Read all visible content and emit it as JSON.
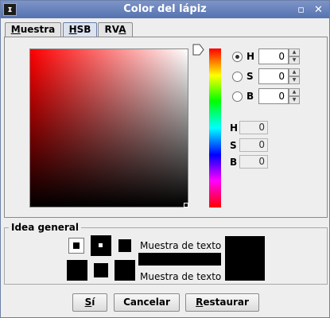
{
  "window": {
    "title": "Color del lápiz"
  },
  "titlebar": {
    "icon": "app-icon",
    "minimize": "minimize-icon",
    "close": "close-icon"
  },
  "tabs": [
    {
      "label": "Muestra",
      "mnemonic": "M",
      "rest": "uestra",
      "active": false
    },
    {
      "label": "HSB",
      "mnemonic": "H",
      "rest": "SB",
      "active": true
    },
    {
      "label": "RVA",
      "pre": "RV",
      "mnemonic": "A",
      "active": false
    }
  ],
  "hsb": {
    "current_color": "#000000",
    "hue_color": "#ff0000",
    "fields": [
      {
        "label": "H",
        "value": "0",
        "selected": true
      },
      {
        "label": "S",
        "value": "0",
        "selected": false
      },
      {
        "label": "B",
        "value": "0",
        "selected": false
      }
    ],
    "readouts": [
      {
        "label": "H",
        "value": "0"
      },
      {
        "label": "S",
        "value": "0"
      },
      {
        "label": "B",
        "value": "0"
      }
    ]
  },
  "preview": {
    "title": "Idea general",
    "sample_text_1": "Muestra de texto",
    "sample_text_2": "Muestra de texto",
    "color": "#000000"
  },
  "buttons": {
    "ok": {
      "mnemonic": "S",
      "rest": "í"
    },
    "cancel": "Cancelar",
    "reset": {
      "mnemonic": "R",
      "rest": "estaurar"
    }
  }
}
